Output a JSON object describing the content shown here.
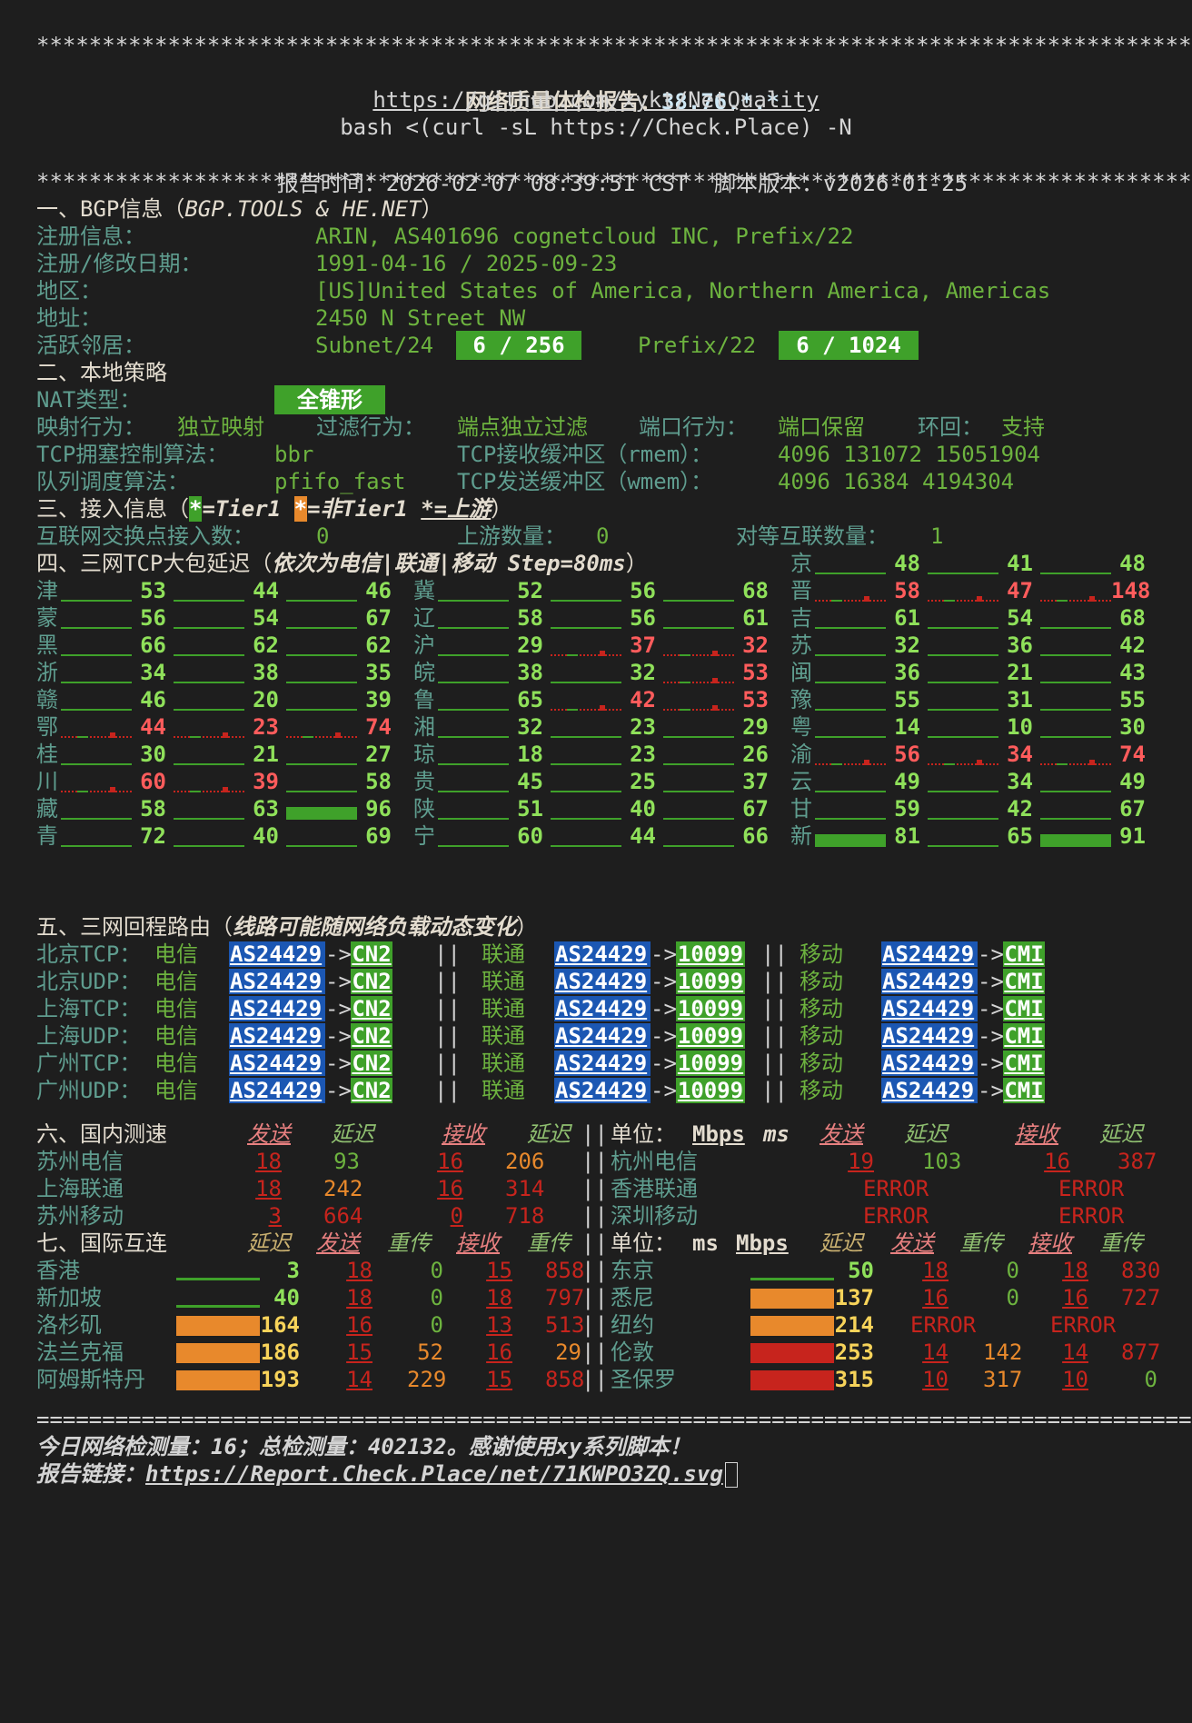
{
  "stars": "*****************************************************************************************",
  "report": {
    "title": "网络质量体检报告：",
    "ip": "38.76.*.*",
    "repo_url": "https://github.com/xykt/NetQuality",
    "command": "bash <(curl -sL https://Check.Place) -N",
    "time_label": "报告时间：",
    "time": "2026-02-07 08:39:51 CST",
    "version_label": "脚本版本：",
    "version": "v2026-01-25"
  },
  "bgp": {
    "heading": "一、BGP信息（",
    "source": "BGP.TOOLS & HE.NET",
    "heading_end": "）",
    "reg_label": "注册信息：",
    "reg": "ARIN, AS401696 cognetcloud INC, Prefix/22",
    "date_label": "注册/修改日期：",
    "date": "1991-04-16 / 2025-09-23",
    "region_label": "地区：",
    "region": "[US]United States of America, Northern America, Americas",
    "addr_label": "地址：",
    "addr": "2450 N Street NW",
    "neighbor_label": "活跃邻居：",
    "subnet_label": "Subnet/24",
    "subnet_value": "6 / 256",
    "prefix_label": "Prefix/22",
    "prefix_value": "6 / 1024"
  },
  "policy": {
    "heading": "二、本地策略",
    "nat_label": "NAT类型：",
    "nat": "全锥形",
    "map_label": "映射行为：",
    "map": "独立映射",
    "filter_label": "过滤行为：",
    "filter": "端点独立过滤",
    "port_label": "端口行为：",
    "port": "端口保留",
    "loop_label": "环回：",
    "loop": "支持",
    "cc_label": "TCP拥塞控制算法：",
    "cc": "bbr",
    "rmem_label": "TCP接收缓冲区（rmem）：",
    "rmem": "4096 131072 15051904",
    "qdisc_label": "队列调度算法：",
    "qdisc": "pfifo_fast",
    "wmem_label": "TCP发送缓冲区（wmem）：",
    "wmem": "4096 16384 4194304"
  },
  "access": {
    "heading": "三、接入信息（",
    "star": "*",
    "tier1": "=Tier1",
    "non_tier1": "=非Tier1",
    "upstream": "*=上游",
    "heading_end": "）",
    "ix_label": "互联网交换点接入数：",
    "ix": "0",
    "up_label": "上游数量：",
    "up": "0",
    "peer_label": "对等互联数量：",
    "peer": "1"
  },
  "latency": {
    "heading": "四、三网TCP大包延迟（",
    "note": "依次为电信|联通|移动 Step=80ms",
    "heading_end": "）",
    "rows": [
      {
        "p": "京",
        "v": [
          "48",
          "41",
          "48"
        ]
      },
      {
        "p": "津",
        "v": [
          "53",
          "44",
          "46"
        ]
      },
      {
        "p": "冀",
        "v": [
          "52",
          "56",
          "68"
        ]
      },
      {
        "p": "晋",
        "v": [
          "58",
          "47",
          "148"
        ]
      },
      {
        "p": "蒙",
        "v": [
          "56",
          "54",
          "67"
        ]
      },
      {
        "p": "辽",
        "v": [
          "58",
          "56",
          "61"
        ]
      },
      {
        "p": "吉",
        "v": [
          "61",
          "54",
          "68"
        ]
      },
      {
        "p": "黑",
        "v": [
          "66",
          "62",
          "62"
        ]
      },
      {
        "p": "沪",
        "v": [
          "29",
          "37",
          "32"
        ]
      },
      {
        "p": "苏",
        "v": [
          "32",
          "36",
          "42"
        ]
      },
      {
        "p": "浙",
        "v": [
          "34",
          "38",
          "35"
        ]
      },
      {
        "p": "皖",
        "v": [
          "38",
          "32",
          "53"
        ]
      },
      {
        "p": "闽",
        "v": [
          "36",
          "21",
          "43"
        ]
      },
      {
        "p": "赣",
        "v": [
          "46",
          "20",
          "39"
        ]
      },
      {
        "p": "鲁",
        "v": [
          "65",
          "42",
          "53"
        ]
      },
      {
        "p": "豫",
        "v": [
          "55",
          "31",
          "55"
        ]
      },
      {
        "p": "鄂",
        "v": [
          "44",
          "23",
          "74"
        ]
      },
      {
        "p": "湘",
        "v": [
          "32",
          "23",
          "29"
        ]
      },
      {
        "p": "粤",
        "v": [
          "14",
          "10",
          "30"
        ]
      },
      {
        "p": "桂",
        "v": [
          "30",
          "21",
          "27"
        ]
      },
      {
        "p": "琼",
        "v": [
          "18",
          "23",
          "26"
        ]
      },
      {
        "p": "渝",
        "v": [
          "56",
          "34",
          "74"
        ]
      },
      {
        "p": "川",
        "v": [
          "60",
          "39",
          "58"
        ]
      },
      {
        "p": "贵",
        "v": [
          "45",
          "25",
          "37"
        ]
      },
      {
        "p": "云",
        "v": [
          "49",
          "34",
          "49"
        ]
      },
      {
        "p": "藏",
        "v": [
          "58",
          "63",
          "96"
        ]
      },
      {
        "p": "陕",
        "v": [
          "51",
          "40",
          "67"
        ]
      },
      {
        "p": "甘",
        "v": [
          "59",
          "42",
          "67"
        ]
      },
      {
        "p": "青",
        "v": [
          "72",
          "40",
          "69"
        ]
      },
      {
        "p": "宁",
        "v": [
          "60",
          "44",
          "66"
        ]
      },
      {
        "p": "新",
        "v": [
          "81",
          "65",
          "91"
        ]
      }
    ]
  },
  "routes": {
    "heading": "五、三网回程路由（",
    "note": "线路可能随网络负载动态变化",
    "heading_end": "）",
    "isp": [
      "电信",
      "联通",
      "移动"
    ],
    "asn": "AS24429",
    "arrow": "->",
    "sep": "||",
    "tags": [
      "CN2",
      "10099",
      "CMI"
    ],
    "rows": [
      "北京TCP：",
      "北京UDP：",
      "上海TCP：",
      "上海UDP：",
      "广州TCP：",
      "广州UDP："
    ]
  },
  "speed": {
    "heading": "六、国内测速",
    "cols": [
      "发送",
      "延迟",
      "接收",
      "延迟"
    ],
    "unit_label": "单位：",
    "unit_mbps": "Mbps",
    "unit_ms": "ms",
    "sep": "||",
    "left": [
      {
        "name": "苏州电信",
        "send": "18",
        "lat1": "93",
        "recv": "16",
        "lat2": "206"
      },
      {
        "name": "上海联通",
        "send": "18",
        "lat1": "242",
        "recv": "16",
        "lat2": "314"
      },
      {
        "name": "苏州移动",
        "send": "3",
        "lat1": "664",
        "recv": "0",
        "lat2": "718"
      }
    ],
    "right": [
      {
        "name": "杭州电信",
        "send": "19",
        "lat1": "103",
        "recv": "16",
        "lat2": "387"
      },
      {
        "name": "香港联通",
        "err1": "ERROR",
        "err2": "ERROR"
      },
      {
        "name": "深圳移动",
        "err1": "ERROR",
        "err2": "ERROR"
      }
    ]
  },
  "intl": {
    "heading": "七、国际互连",
    "cols": [
      "延迟",
      "发送",
      "重传",
      "接收",
      "重传"
    ],
    "unit_label": "单位：",
    "unit_ms": "ms",
    "unit_mbps": "Mbps",
    "left": [
      {
        "name": "香港",
        "lat": "3",
        "send": "18",
        "r1": "0",
        "recv": "15",
        "r2": "858"
      },
      {
        "name": "新加坡",
        "lat": "40",
        "send": "18",
        "r1": "0",
        "recv": "18",
        "r2": "797"
      },
      {
        "name": "洛杉矶",
        "lat": "164",
        "send": "16",
        "r1": "0",
        "recv": "13",
        "r2": "513"
      },
      {
        "name": "法兰克福",
        "lat": "186",
        "send": "15",
        "r1": "52",
        "recv": "16",
        "r2": "29"
      },
      {
        "name": "阿姆斯特丹",
        "lat": "193",
        "send": "14",
        "r1": "229",
        "recv": "15",
        "r2": "858"
      }
    ],
    "right": [
      {
        "name": "东京",
        "lat": "50",
        "send": "18",
        "r1": "0",
        "recv": "18",
        "r2": "830"
      },
      {
        "name": "悉尼",
        "lat": "137",
        "send": "16",
        "r1": "0",
        "recv": "16",
        "r2": "727"
      },
      {
        "name": "纽约",
        "lat": "214",
        "err1": "ERROR",
        "err2": "ERROR"
      },
      {
        "name": "伦敦",
        "lat": "253",
        "send": "14",
        "r1": "142",
        "recv": "14",
        "r2": "877"
      },
      {
        "name": "圣保罗",
        "lat": "315",
        "send": "10",
        "r1": "317",
        "recv": "10",
        "r2": "0"
      }
    ]
  },
  "rule": "=========================================================================================",
  "footer": {
    "today_label": "今日网络检测量：",
    "today": "16",
    "total_label": "；总检测量：",
    "total": "402132",
    "thanks": "。感谢使用xy系列脚本！",
    "link_label": "报告链接：",
    "link": "https://Report.Check.Place/net/71KWPO3ZQ.svg"
  },
  "colors": {
    "bg": "#1e1e1e",
    "green": "#3fa12a",
    "blue": "#1b57b3",
    "red": "#ff5c5c",
    "orange": "#e8892c",
    "darkred": "#c7241d"
  }
}
